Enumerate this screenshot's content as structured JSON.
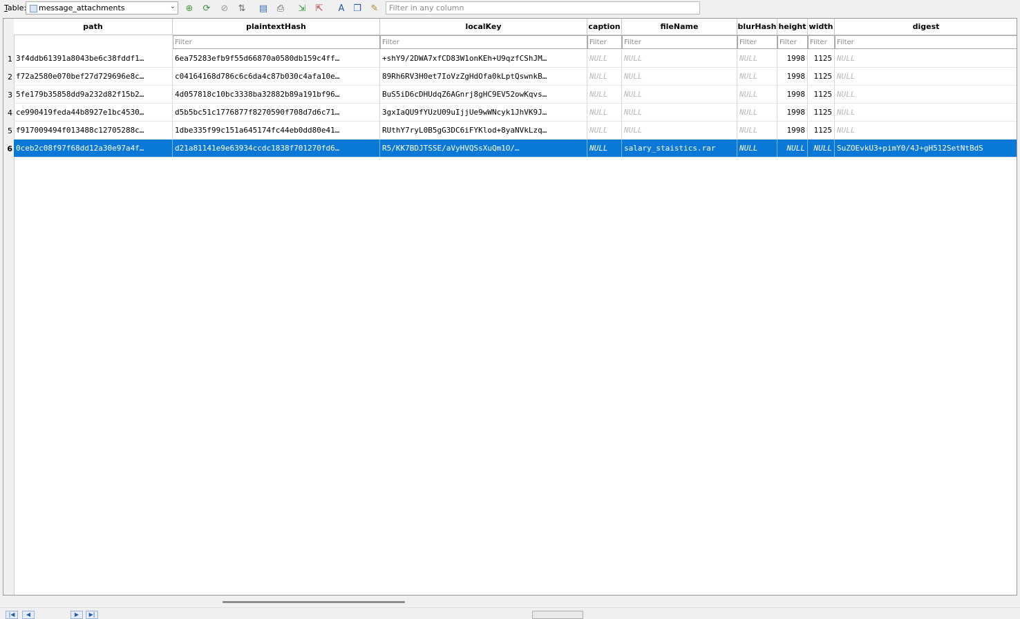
{
  "toolbar": {
    "table_label_prefix": "T",
    "table_label_rest": "able:",
    "table_name": "message_attachments",
    "search_placeholder": "Filter in any column",
    "buttons": [
      {
        "name": "create-record-icon",
        "glyph": "⊕",
        "color": "#4a9a3a"
      },
      {
        "name": "refresh-icon",
        "glyph": "⟳",
        "color": "#3b8f3b"
      },
      {
        "name": "clear-filters-icon",
        "glyph": "⊘",
        "color": "#9a9a9a"
      },
      {
        "name": "sort-icon",
        "glyph": "⇅",
        "color": "#6a6a6a"
      },
      {
        "name": "save-table-icon",
        "glyph": "▤",
        "color": "#3a6fb5"
      },
      {
        "name": "print-icon",
        "glyph": "⎙",
        "color": "#555555"
      },
      {
        "name": "insert-record-icon",
        "glyph": "⇲",
        "color": "#3a9a3a"
      },
      {
        "name": "delete-record-icon",
        "glyph": "⇱",
        "color": "#c03a3a"
      },
      {
        "name": "text-format-icon",
        "glyph": "A",
        "color": "#2a5aa0"
      },
      {
        "name": "encoding-icon",
        "glyph": "❐",
        "color": "#2a5aa0"
      },
      {
        "name": "table-settings-icon",
        "glyph": "✎",
        "color": "#b08a2a"
      }
    ]
  },
  "grid": {
    "filter_placeholder": "Filter",
    "columns": [
      "path",
      "plaintextHash",
      "localKey",
      "caption",
      "fileName",
      "blurHash",
      "height",
      "width",
      "digest"
    ],
    "rows": [
      {
        "num": "1",
        "path": "3f4ddb61391a8043be6c38fddf1…",
        "plaintextHash": "6ea75283efb9f55d66870a0580db159c4ff…",
        "localKey": "+shY9/2DWA7xfCD83W1onKEh+U9qzfCShJM…",
        "caption": "NULL",
        "fileName": "NULL",
        "blurHash": "NULL",
        "height": "1998",
        "width": "1125",
        "digest": "NULL"
      },
      {
        "num": "2",
        "path": "f72a2580e070bef27d729696e8c…",
        "plaintextHash": "c04164168d786c6c6da4c87b030c4afa10e…",
        "localKey": "89Rh6RV3H0et7IoVzZgHdOfa0kLptQswnkB…",
        "caption": "NULL",
        "fileName": "NULL",
        "blurHash": "NULL",
        "height": "1998",
        "width": "1125",
        "digest": "NULL"
      },
      {
        "num": "3",
        "path": "5fe179b35858dd9a232d82f15b2…",
        "plaintextHash": "4d057818c10bc3338ba32882b89a191bf96…",
        "localKey": "BuS5iD6cDHUdqZ6AGnrj8gHC9EV52owKqvs…",
        "caption": "NULL",
        "fileName": "NULL",
        "blurHash": "NULL",
        "height": "1998",
        "width": "1125",
        "digest": "NULL"
      },
      {
        "num": "4",
        "path": "ce990419feda44b8927e1bc4530…",
        "plaintextHash": "d5b5bc51c1776877f8270590f708d7d6c71…",
        "localKey": "3gxIaQU9fYUzU09uIjjUe9wWNcyk1JhVK9J…",
        "caption": "NULL",
        "fileName": "NULL",
        "blurHash": "NULL",
        "height": "1998",
        "width": "1125",
        "digest": "NULL"
      },
      {
        "num": "5",
        "path": "f917009494f013488c12705288c…",
        "plaintextHash": "1dbe335f99c151a645174fc44eb0dd80e41…",
        "localKey": "RUthY7ryL0B5gG3DC6iFYKlod+8yaNVkLzq…",
        "caption": "NULL",
        "fileName": "NULL",
        "blurHash": "NULL",
        "height": "1998",
        "width": "1125",
        "digest": "NULL"
      },
      {
        "num": "6",
        "path": "0ceb2c08f97f68dd12a30e97a4f…",
        "plaintextHash": "d21a81141e9e63934ccdc1838f701270fd6…",
        "localKey": "R5/KK7BDJTSSE/aVyHVQSsXuQm1O/…",
        "caption": "NULL",
        "fileName": "salary_staistics.rar",
        "blurHash": "NULL",
        "height": "NULL",
        "width": "NULL",
        "digest": "SuZOEvkU3+pimY0/4J+gH512SetNtBdS"
      }
    ]
  },
  "colors": {
    "selection": "#0a78d7",
    "null_text": "#b8b8b8"
  }
}
